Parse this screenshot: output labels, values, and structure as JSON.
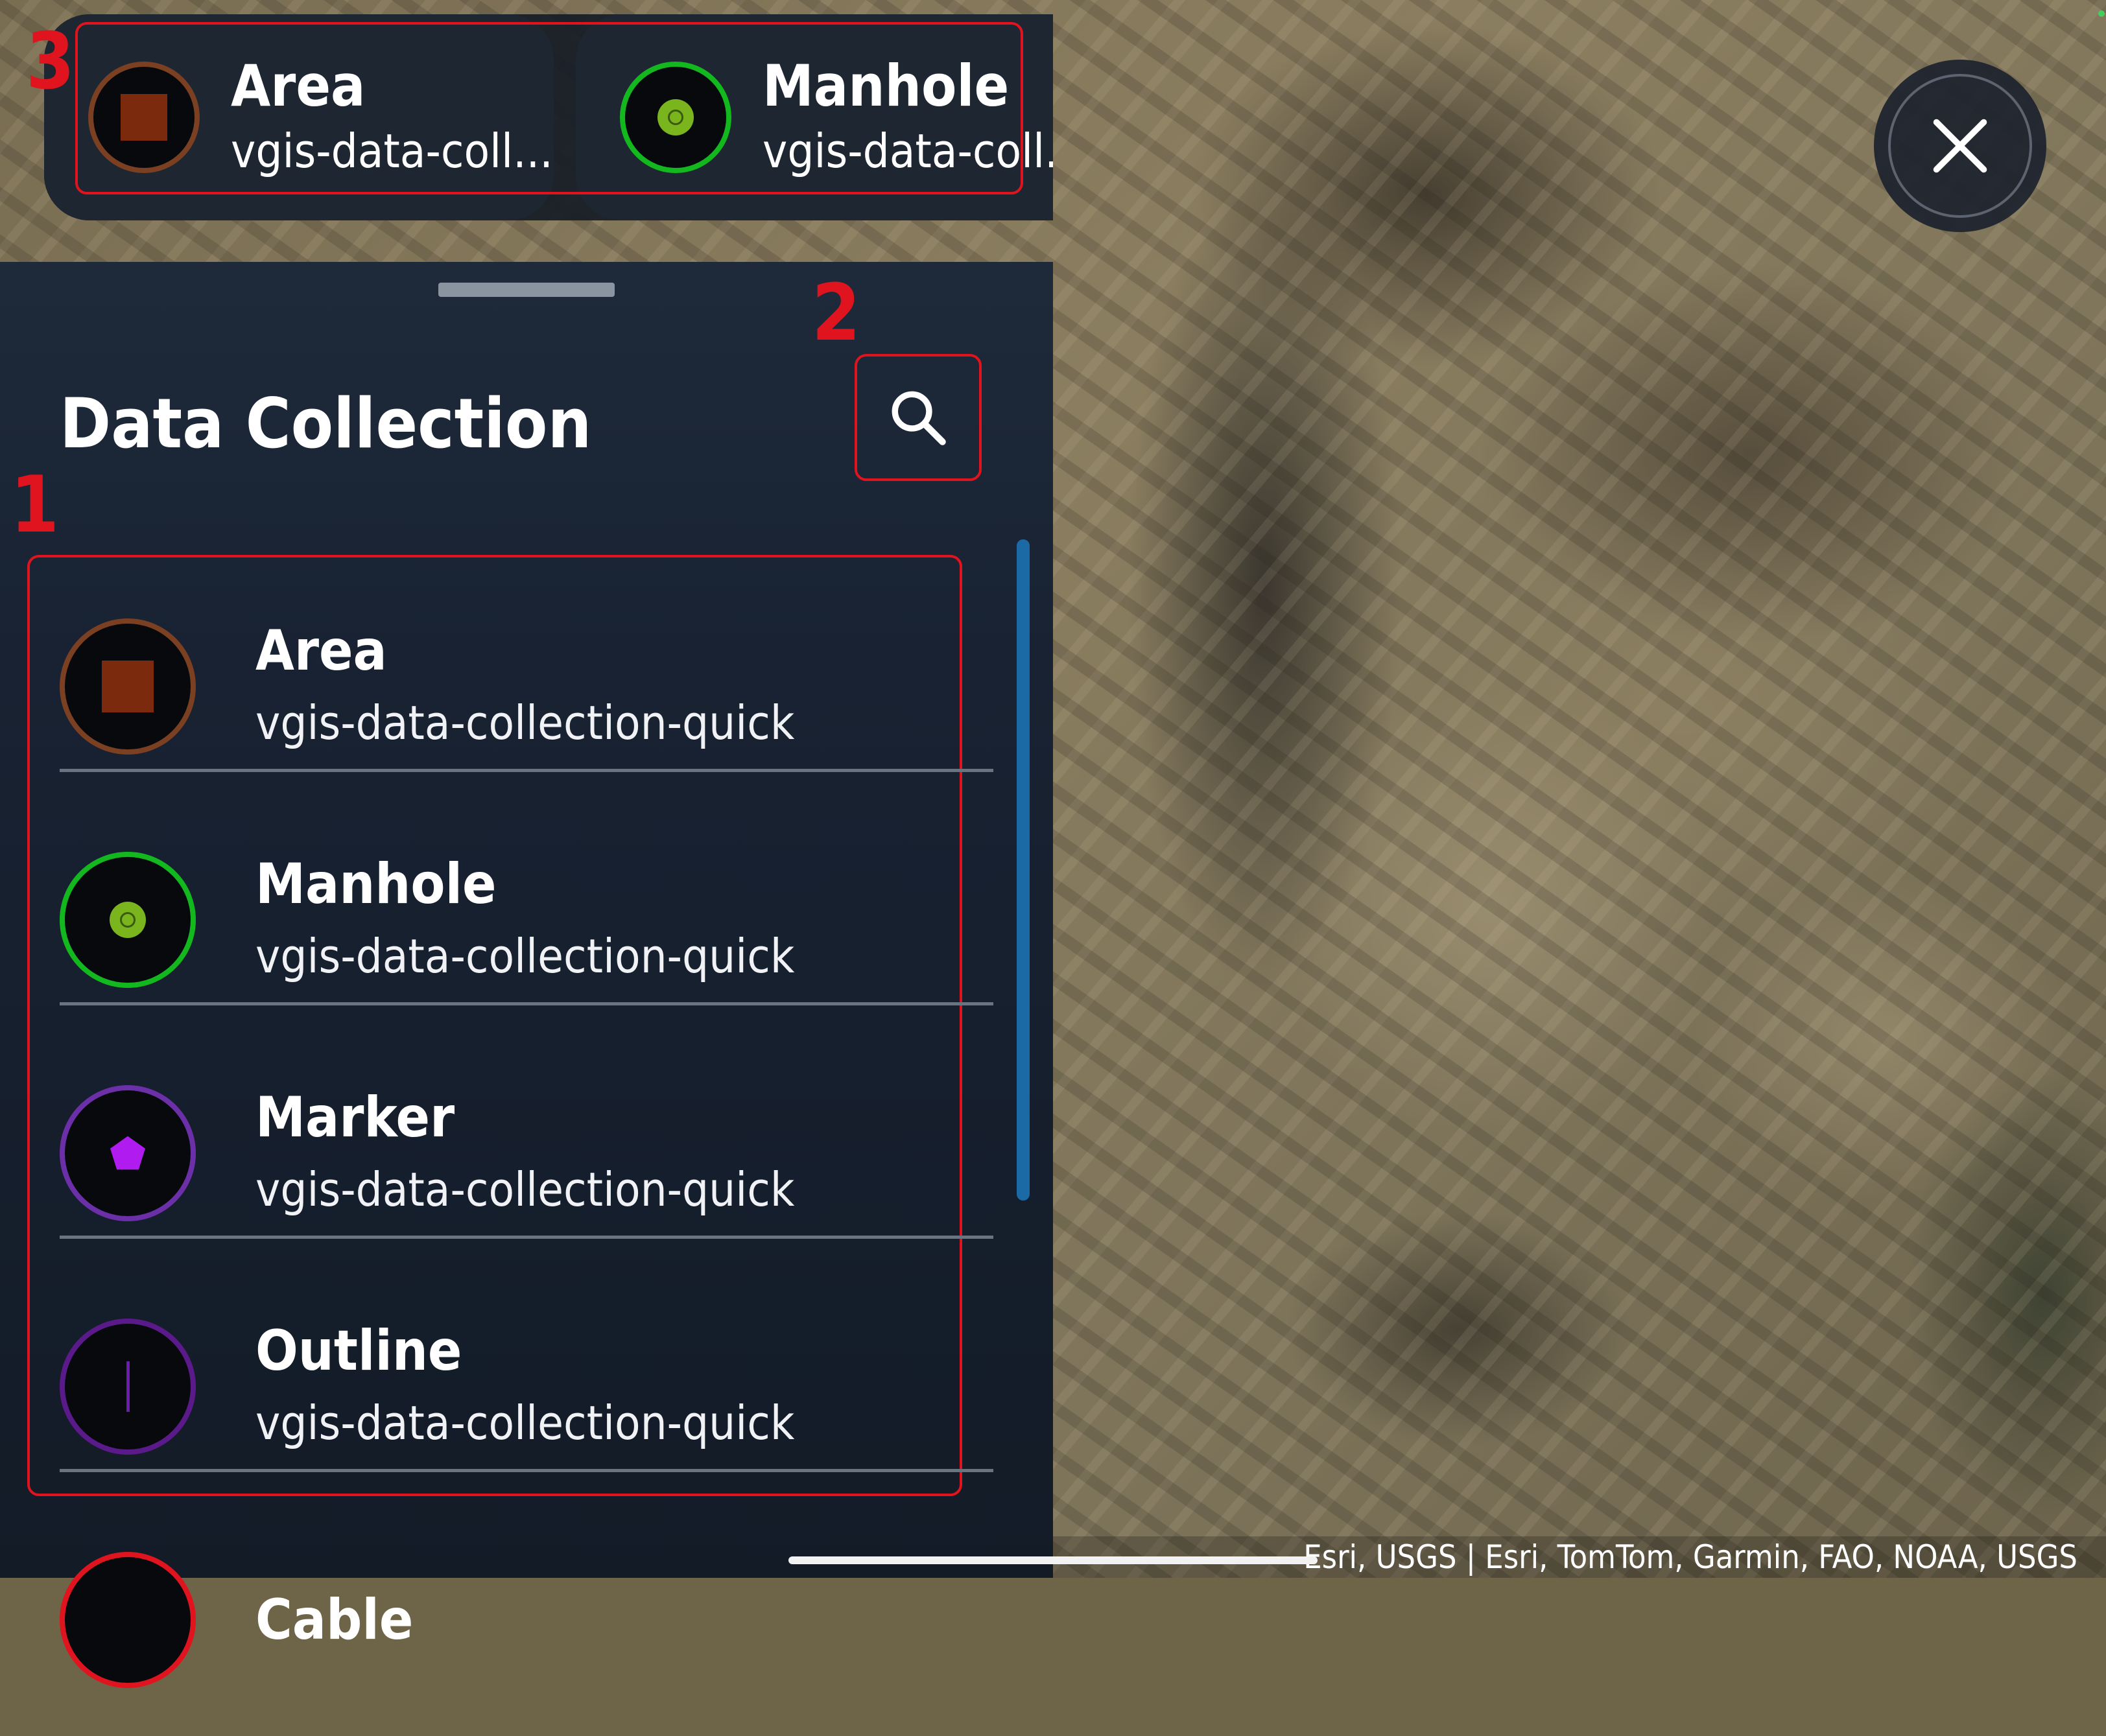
{
  "map": {
    "attribution": "Esri, USGS | Esri, TomTom, Garmin, FAO, NOAA, USGS",
    "close_icon": "close-icon"
  },
  "quick_bar": {
    "badge": "3",
    "chips": [
      {
        "title": "Area",
        "subtitle": "vgis-data-coll...",
        "icon": "area-square-icon",
        "color": "#7b2a0e"
      },
      {
        "title": "Manhole",
        "subtitle": "vgis-data-coll...",
        "icon": "manhole-dot-icon",
        "color": "#7ab51d"
      }
    ]
  },
  "panel": {
    "title": "Data Collection",
    "search_badge": "2",
    "list_badge": "1",
    "search_icon": "search-icon",
    "items": [
      {
        "title": "Area",
        "subtitle": "vgis-data-collection-quick",
        "icon": "area-square-icon",
        "color": "#7b2a0e"
      },
      {
        "title": "Manhole",
        "subtitle": "vgis-data-collection-quick",
        "icon": "manhole-dot-icon",
        "color": "#12b81e"
      },
      {
        "title": "Marker",
        "subtitle": "vgis-data-collection-quick",
        "icon": "marker-pentagon-icon",
        "color": "#a020e0"
      },
      {
        "title": "Outline",
        "subtitle": "vgis-data-collection-quick",
        "icon": "outline-line-icon",
        "color": "#6e1bb0"
      },
      {
        "title": "Cable",
        "subtitle": "",
        "icon": "cable-icon",
        "color": "#e0141e"
      }
    ]
  }
}
